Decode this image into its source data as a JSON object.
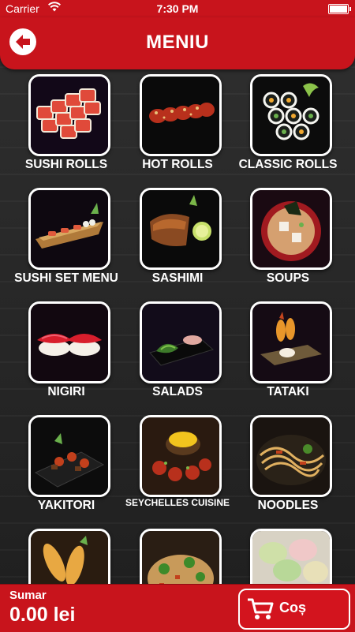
{
  "status_bar": {
    "carrier": "Carrier",
    "time": "7:30 PM",
    "wifi_icon": "wifi-icon",
    "battery_icon": "battery-icon"
  },
  "header": {
    "title": "MENIU",
    "back_icon": "back-arrow-icon"
  },
  "categories": [
    {
      "label": "SUSHI ROLLS"
    },
    {
      "label": "HOT ROLLS"
    },
    {
      "label": "CLASSIC ROLLS"
    },
    {
      "label": "SUSHI SET MENU"
    },
    {
      "label": "SASHIMI"
    },
    {
      "label": "SOUPS"
    },
    {
      "label": "NIGIRI"
    },
    {
      "label": "SALADS"
    },
    {
      "label": "TATAKI"
    },
    {
      "label": "YAKITORI"
    },
    {
      "label": "SEYCHELLES CUISINE"
    },
    {
      "label": "NOODLES"
    },
    {
      "label": ""
    },
    {
      "label": ""
    },
    {
      "label": ""
    }
  ],
  "footer": {
    "summary_label": "Sumar",
    "summary_value": "0.00 lei",
    "cart_label": "Coș",
    "cart_icon": "shopping-cart-icon"
  },
  "colors": {
    "accent": "#c8141c",
    "tile_border": "#ffffff",
    "background": "#2a2a2a"
  }
}
